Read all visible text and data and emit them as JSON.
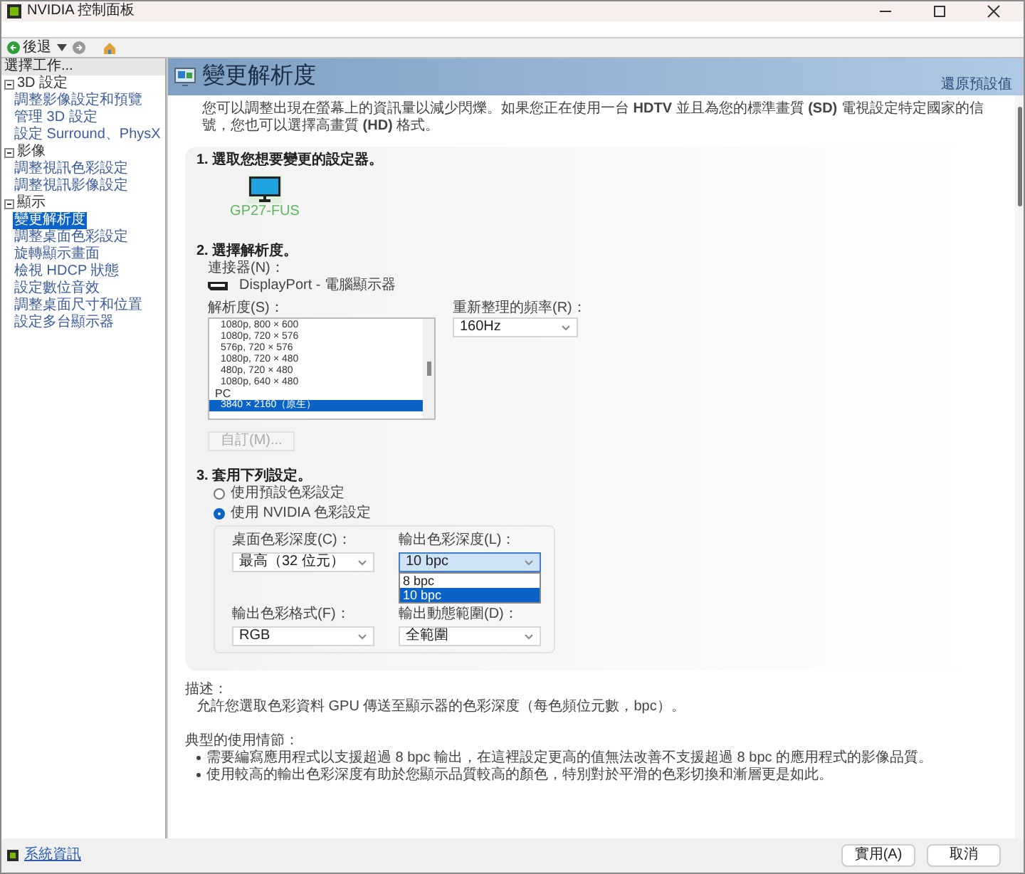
{
  "window": {
    "title": "NVIDIA 控制面板"
  },
  "toolbar": {
    "back_label": "後退"
  },
  "sidebar": {
    "header": "選擇工作...",
    "items": [
      {
        "label": "3D 設定",
        "expanded": true,
        "children": [
          {
            "label": "調整影像設定和預覽",
            "selected": false
          },
          {
            "label": "管理 3D 設定",
            "selected": false
          },
          {
            "label": "設定 Surround、PhysX",
            "selected": false
          }
        ]
      },
      {
        "label": "影像",
        "expanded": true,
        "children": [
          {
            "label": "調整視訊色彩設定",
            "selected": false
          },
          {
            "label": "調整視訊影像設定",
            "selected": false
          }
        ]
      },
      {
        "label": "顯示",
        "expanded": true,
        "children": [
          {
            "label": "變更解析度",
            "selected": true
          },
          {
            "label": "調整桌面色彩設定",
            "selected": false
          },
          {
            "label": "旋轉顯示畫面",
            "selected": false
          },
          {
            "label": "檢視 HDCP 狀態",
            "selected": false
          },
          {
            "label": "設定數位音效",
            "selected": false
          },
          {
            "label": "調整桌面尺寸和位置",
            "selected": false
          },
          {
            "label": "設定多台顯示器",
            "selected": false
          }
        ]
      }
    ],
    "footer_link": "系統資訊"
  },
  "page": {
    "title": "變更解析度",
    "restore_link": "還原預設值",
    "intro": "您可以調整出現在螢幕上的資訊量以減少閃爍。如果您正在使用一台 **HDTV** 並且為您的標準畫質 **(SD)** 電視設定特定國家的信號，您也可以選擇高畫質 **(HD)** 格式。",
    "step1": {
      "heading": "1. 選取您想要變更的設定器。",
      "display": {
        "name": "GP27-FUS",
        "selected": true
      }
    },
    "step2": {
      "heading": "2. 選擇解析度。",
      "connector_label": "連接器(N)：",
      "connector": "DisplayPort - 電腦顯示器",
      "resolution_label": "解析度(S)：",
      "resolutions": [
        {
          "kind": "item",
          "label": "1080p, 800 × 600",
          "selected": false
        },
        {
          "kind": "item",
          "label": "1080p, 720 × 576",
          "selected": false
        },
        {
          "kind": "item",
          "label": "576p, 720 × 576",
          "selected": false
        },
        {
          "kind": "item",
          "label": "1080p, 720 × 480",
          "selected": false
        },
        {
          "kind": "item",
          "label": "480p, 720 × 480",
          "selected": false
        },
        {
          "kind": "item",
          "label": "1080p, 640 × 480",
          "selected": false
        },
        {
          "kind": "group",
          "label": "PC"
        },
        {
          "kind": "item",
          "label": "3840 × 2160（原生）",
          "selected": true
        }
      ],
      "refresh_label": "重新整理的頻率(R)：",
      "refresh": "160Hz",
      "custom_button": {
        "label": "自訂(M)...",
        "disabled": true
      }
    },
    "step3": {
      "heading": "3. 套用下列設定。",
      "options": [
        {
          "label": "使用預設色彩設定",
          "selected": false
        },
        {
          "label": "使用 NVIDIA 色彩設定",
          "selected": true
        }
      ],
      "desktop_depth": {
        "label": "桌面色彩深度(C)：",
        "value": "最高（32 位元）"
      },
      "output_depth": {
        "label": "輸出色彩深度(L)：",
        "value": "10 bpc",
        "expanded": true,
        "options": [
          {
            "label": "8 bpc",
            "selected": false
          },
          {
            "label": "10 bpc",
            "selected": true
          }
        ]
      },
      "output_format": {
        "label": "輸出色彩格式(F)：",
        "value": "RGB"
      },
      "dynamic_range": {
        "label": "輸出動態範圍(D)：",
        "value": "全範圍"
      }
    },
    "description": {
      "heading": "描述：",
      "text": "允許您選取色彩資料 GPU 傳送至顯示器的色彩深度（每色頻位元數，bpc）。"
    },
    "usage": {
      "heading": "典型的使用情節：",
      "bullets": [
        "需要編寫應用程式以支援超過 8 bpc 輸出，在這裡設定更高的值無法改善不支援超過 8 bpc 的應用程式的影像品質。",
        "使用較高的輸出色彩深度有助於您顯示品質較高的顏色，特別對於平滑的色彩切換和漸層更是如此。"
      ]
    }
  },
  "buttons": [
    {
      "label": "實用(A)"
    },
    {
      "label": "取消"
    }
  ]
}
